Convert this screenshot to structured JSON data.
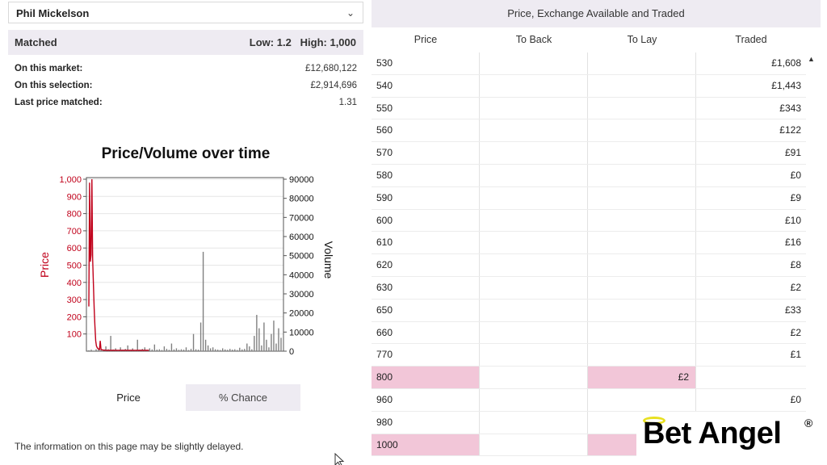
{
  "selection": {
    "name": "Phil Mickelson"
  },
  "matched": {
    "title": "Matched",
    "low_high": "Low: 1.2   High: 1,000",
    "stats": [
      {
        "label": "On this market:",
        "value": "£12,680,122"
      },
      {
        "label": "On this selection:",
        "value": "£2,914,696"
      },
      {
        "label": "Last price matched:",
        "value": "1.31"
      }
    ]
  },
  "chart": {
    "title": "Price/Volume over time"
  },
  "chart_data": {
    "type": "line",
    "title": "Price/Volume over time",
    "ylabel": "Price",
    "y2label": "Volume",
    "price_ticks": [
      "100",
      "200",
      "300",
      "400",
      "500",
      "600",
      "700",
      "800",
      "900",
      "1,000"
    ],
    "volume_ticks": [
      "0",
      "10000",
      "20000",
      "30000",
      "40000",
      "50000",
      "60000",
      "70000",
      "80000",
      "90000"
    ],
    "ylim": [
      0,
      1000
    ],
    "y2lim": [
      0,
      90000
    ],
    "price_color": "#c0001a",
    "volume_color": "#808080",
    "series": [
      {
        "name": "Price",
        "values": [
          260,
          980,
          520,
          560,
          1000,
          540,
          400,
          250,
          150,
          60,
          30,
          20,
          15,
          12,
          10,
          60,
          10,
          8,
          8,
          6,
          6,
          6,
          6,
          5,
          5,
          5,
          5,
          5,
          5,
          5,
          5,
          5,
          5,
          5,
          5,
          5,
          5,
          5,
          5,
          5,
          5,
          5,
          5,
          5,
          5,
          5,
          5,
          5,
          5,
          5,
          5,
          5,
          5,
          5,
          5,
          5,
          5,
          5,
          5,
          5,
          5,
          5,
          5,
          5,
          5,
          5,
          5,
          5,
          5,
          5,
          5,
          5,
          5,
          5,
          5,
          5,
          5,
          5,
          5,
          5
        ]
      },
      {
        "name": "Volume",
        "values": [
          500,
          800,
          300,
          1000,
          1200,
          600,
          800,
          2500,
          1000,
          8000,
          900,
          1500,
          600,
          2000,
          800,
          1200,
          3000,
          700,
          1500,
          500,
          6000,
          800,
          1200,
          2000,
          700,
          1500,
          900,
          3500,
          800,
          1000,
          600,
          2500,
          1200,
          700,
          4000,
          900,
          1500,
          700,
          1000,
          800,
          2000,
          600,
          1200,
          9000,
          1000,
          800,
          15000,
          52000,
          6000,
          3000,
          1500,
          2000,
          1000,
          800,
          600,
          1500,
          900,
          700,
          1200,
          800,
          1000,
          600,
          1800,
          900,
          1200,
          4000,
          2500,
          1000,
          8000,
          19000,
          12000,
          3000,
          15000,
          6000,
          2000,
          9000,
          16000,
          4000,
          12000,
          7000
        ]
      }
    ]
  },
  "toggle": {
    "price": "Price",
    "chance": "% Chance"
  },
  "delay_note": "The information on this page may be slightly delayed.",
  "ladder": {
    "title": "Price, Exchange Available and Traded",
    "headers": {
      "price": "Price",
      "back": "To Back",
      "lay": "To Lay",
      "traded": "Traded"
    },
    "rows": [
      {
        "price": "530",
        "back": "",
        "lay": "",
        "traded": "£1,608",
        "highlight": false
      },
      {
        "price": "540",
        "back": "",
        "lay": "",
        "traded": "£1,443",
        "highlight": false
      },
      {
        "price": "550",
        "back": "",
        "lay": "",
        "traded": "£343",
        "highlight": false
      },
      {
        "price": "560",
        "back": "",
        "lay": "",
        "traded": "£122",
        "highlight": false
      },
      {
        "price": "570",
        "back": "",
        "lay": "",
        "traded": "£91",
        "highlight": false
      },
      {
        "price": "580",
        "back": "",
        "lay": "",
        "traded": "£0",
        "highlight": false
      },
      {
        "price": "590",
        "back": "",
        "lay": "",
        "traded": "£9",
        "highlight": false
      },
      {
        "price": "600",
        "back": "",
        "lay": "",
        "traded": "£10",
        "highlight": false
      },
      {
        "price": "610",
        "back": "",
        "lay": "",
        "traded": "£16",
        "highlight": false
      },
      {
        "price": "620",
        "back": "",
        "lay": "",
        "traded": "£8",
        "highlight": false
      },
      {
        "price": "630",
        "back": "",
        "lay": "",
        "traded": "£2",
        "highlight": false
      },
      {
        "price": "650",
        "back": "",
        "lay": "",
        "traded": "£33",
        "highlight": false
      },
      {
        "price": "660",
        "back": "",
        "lay": "",
        "traded": "£2",
        "highlight": false
      },
      {
        "price": "770",
        "back": "",
        "lay": "",
        "traded": "£1",
        "highlight": false
      },
      {
        "price": "800",
        "back": "",
        "lay": "£2",
        "traded": "",
        "highlight": true
      },
      {
        "price": "960",
        "back": "",
        "lay": "",
        "traded": "£0",
        "highlight": false
      },
      {
        "price": "980",
        "back": "",
        "lay": "",
        "traded": "",
        "highlight": false
      },
      {
        "price": "1000",
        "back": "",
        "lay": "",
        "traded": "",
        "highlight": true
      }
    ]
  },
  "logo": {
    "text": "Bet Angel",
    "reg": "®"
  }
}
